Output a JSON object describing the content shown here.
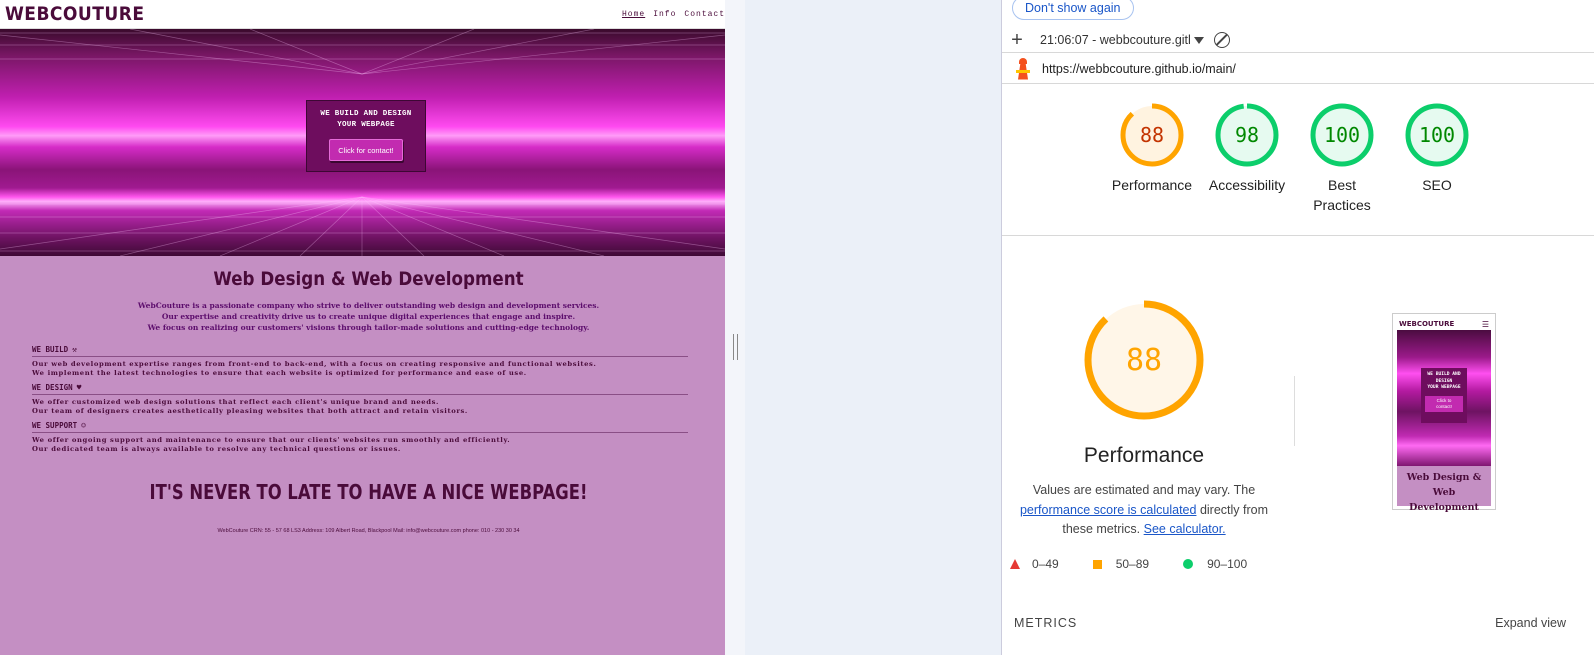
{
  "site": {
    "logo": "WEBCOUTURE",
    "nav": [
      "Home",
      "Info",
      "Contact"
    ],
    "hero_title": "WE BUILD AND DESIGN\nYOUR WEBPAGE",
    "hero_button": "Click for contact!",
    "section_title": "Web Design & Web Development",
    "intro": [
      "WebCouture is a passionate company who strive to deliver outstanding web design and development services.",
      "Our expertise and creativity drive us to create unique digital experiences that engage and inspire.",
      "We focus on realizing our customers' visions through tailor-made solutions and cutting-edge technology."
    ],
    "services": [
      {
        "title": "WE BUILD",
        "icon": "hammer-icon",
        "glyph": "⚒",
        "lines": [
          "Our web development expertise ranges from front-end to back-end, with a focus on creating responsive and functional websites.",
          "We implement the latest technologies to ensure that each website is optimized for performance and ease of use."
        ]
      },
      {
        "title": "WE DESIGN",
        "icon": "palette-icon",
        "glyph": "♥",
        "lines": [
          "We offer customized web design solutions that reflect each client's unique brand and needs.",
          "Our team of designers creates aesthetically pleasing websites that both attract and retain visitors."
        ]
      },
      {
        "title": "WE SUPPORT",
        "icon": "support-icon",
        "glyph": "☺",
        "lines": [
          "We offer ongoing support and maintenance to ensure that our clients' websites run smoothly and efficiently.",
          "Our dedicated team is always available to resolve any technical questions or issues."
        ]
      }
    ],
    "cta": "IT'S NEVER TO LATE TO HAVE A NICE WEBPAGE!",
    "footer": "WebCouture CRN: 55 - 57 68 LS3 Address: 109 Albert Road, Blackpool Mail: info@webcouture.com phone: 010 - 230 30 34"
  },
  "lighthouse": {
    "dont_show_again": "Don't show again",
    "add_icon": "plus-icon",
    "report_selector": "21:06:07 - webbcouture.githu",
    "url": "https://webbcouture.github.io/main/",
    "scores": [
      {
        "label": "Performance",
        "value": 88,
        "color": "#ffa400",
        "text_color": "#c33300",
        "bg": "#fff3e0"
      },
      {
        "label": "Accessibility",
        "value": 98,
        "color": "#0cce6b",
        "text_color": "#008800",
        "bg": "#e6faf0"
      },
      {
        "label": "Best Practices",
        "value": 100,
        "color": "#0cce6b",
        "text_color": "#008800",
        "bg": "#e6faf0"
      },
      {
        "label": "SEO",
        "value": 100,
        "color": "#0cce6b",
        "text_color": "#008800",
        "bg": "#e6faf0"
      }
    ],
    "main_score": {
      "label": "Performance",
      "value": 88,
      "color": "#ffa400",
      "bg": "#fff6e8"
    },
    "note_text_1": "Values are estimated and may vary. The",
    "note_link_1": "performance score is calculated",
    "note_text_2": "directly from these metrics.",
    "note_link_2": "See calculator.",
    "legend": [
      "0–49",
      "50–89",
      "90–100"
    ],
    "legend_colors": {
      "fail": "#e53935",
      "average": "#ffa400",
      "pass": "#0cce6b"
    },
    "metrics_label": "METRICS",
    "expand_view": "Expand view",
    "thumbnail": {
      "logo": "WEBCOUTURE",
      "menu_icon": "menu-icon",
      "hero_title": "WE BUILD AND\nDESIGN\nYOUR WEBPAGE",
      "button": "Click to\ncontact!",
      "heading": "Web Design & Web\nDevelopment"
    }
  }
}
